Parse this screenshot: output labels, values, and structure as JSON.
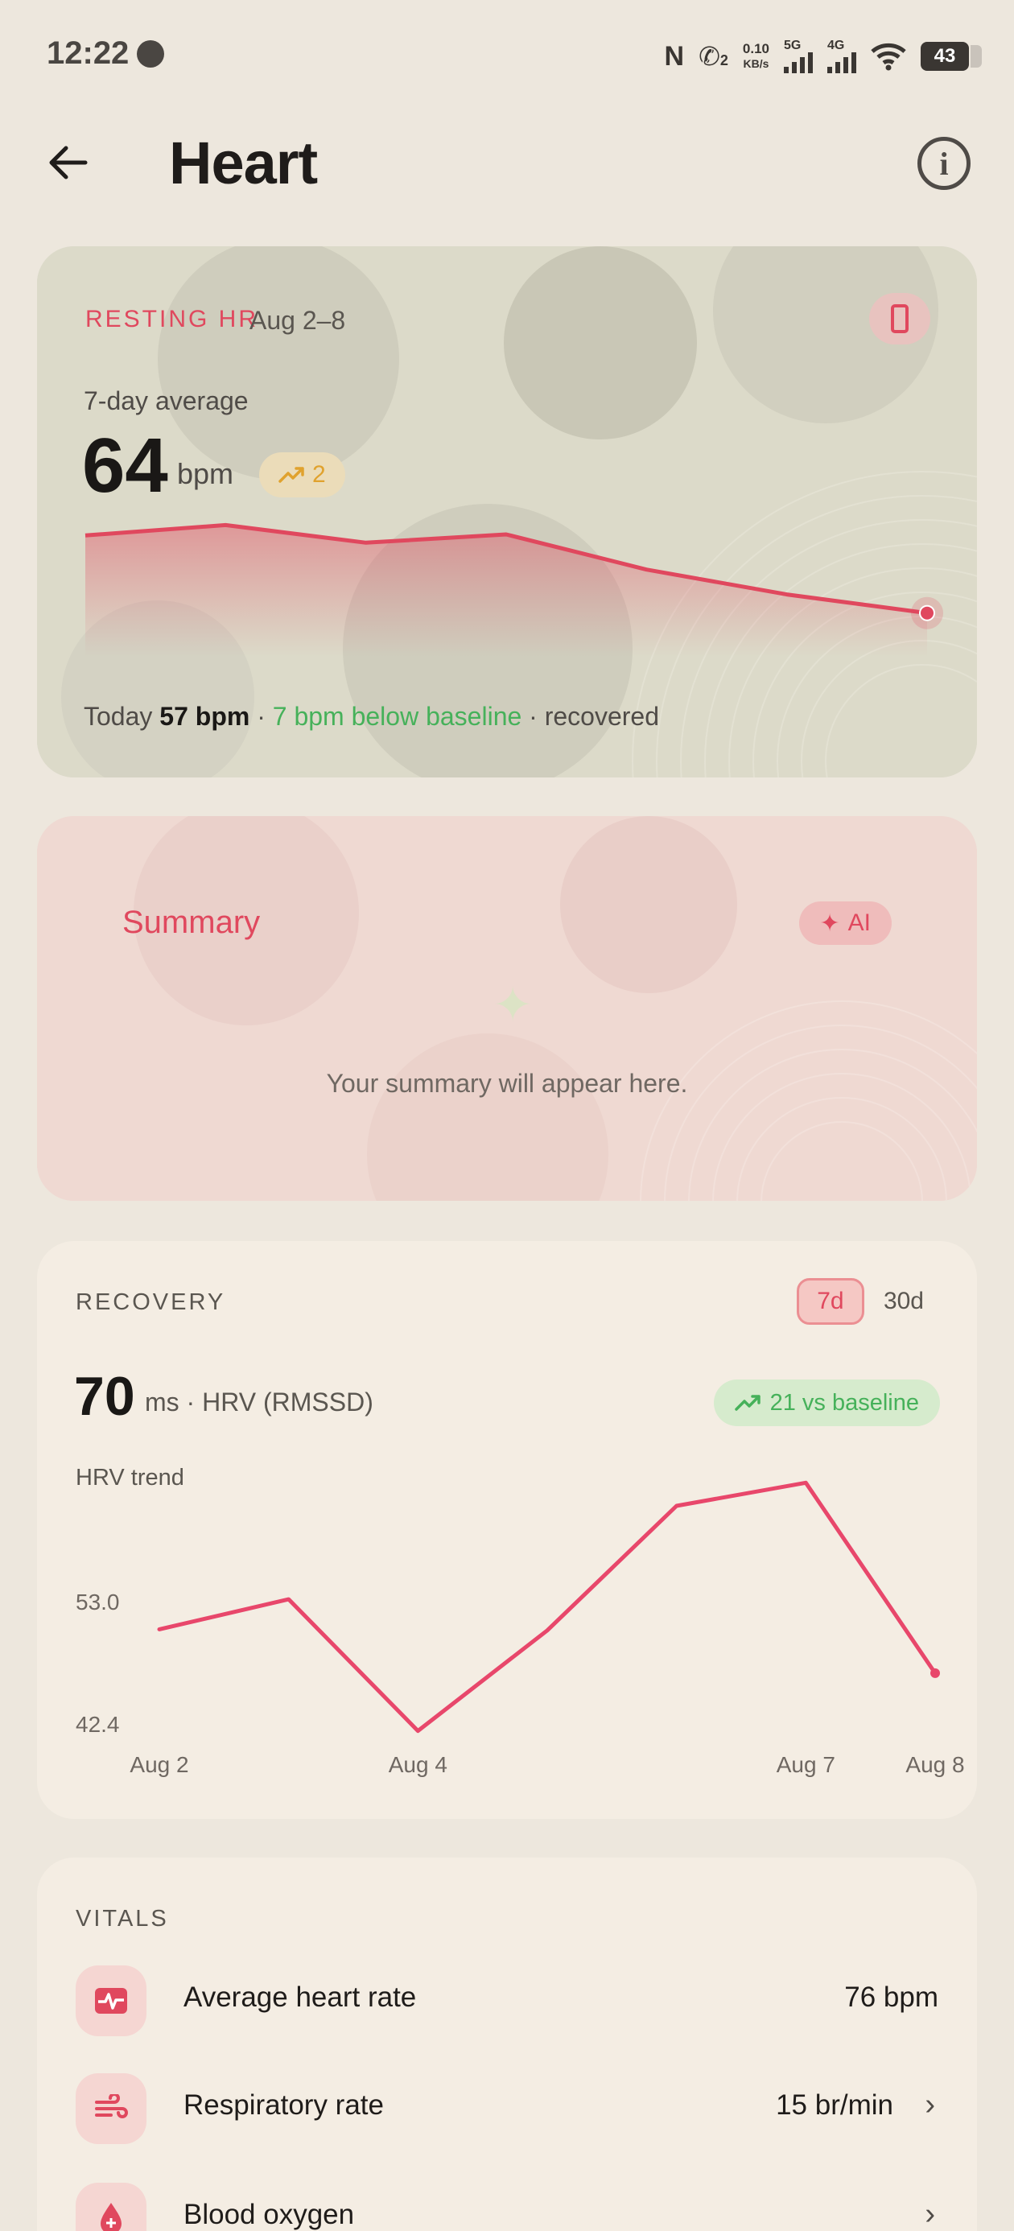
{
  "status_bar": {
    "time": "12:22",
    "speed_value": "0.10",
    "speed_unit": "KB/s",
    "sim1_label": "5G",
    "sim2_label": "4G",
    "call_sub": "2",
    "battery": "43"
  },
  "header": {
    "title": "Heart"
  },
  "resting_hr": {
    "label": "RESTING HR",
    "range": "Aug 2–8",
    "sub_label": "7-day average",
    "value": "64",
    "unit": "bpm",
    "trend_value": "2",
    "footer_prefix": "Today",
    "footer_value": "57 bpm",
    "footer_sep1": " · ",
    "footer_delta": "7 bpm below baseline",
    "footer_suffix": " · recovered",
    "colors": {
      "accent": "#e0485e",
      "trend": "#e0a22e",
      "good": "#46b15a"
    },
    "sparkline": [
      64.5,
      65.5,
      63.8,
      64.6,
      61.2,
      58.8,
      57.0
    ]
  },
  "summary": {
    "title": "Summary",
    "ai_label": "AI",
    "placeholder": "Your summary will appear here."
  },
  "recovery": {
    "label": "RECOVERY",
    "tabs": [
      "7d",
      "30d"
    ],
    "active_tab": "7d",
    "value": "70",
    "unit": "ms · HRV (RMSSD)",
    "badge": "21 vs baseline",
    "chart_title": "HRV trend"
  },
  "chart_data": {
    "type": "line",
    "title": "HRV trend",
    "x": [
      "Aug 2",
      "Aug 3",
      "Aug 4",
      "Aug 5",
      "Aug 6",
      "Aug 7",
      "Aug 8"
    ],
    "x_tick_labels": [
      "Aug 2",
      "Aug 4",
      "Aug 7",
      "Aug 8"
    ],
    "y_tick_labels": [
      "53.0",
      "42.4"
    ],
    "ylim": [
      42.4,
      53.0
    ],
    "series": [
      {
        "values": [
          50.6,
          53.2,
          41.8,
          50.5,
          61.3,
          63.3,
          46.8
        ]
      }
    ],
    "grid": false,
    "color": "#e8476b"
  },
  "vitals": {
    "label": "VITALS",
    "items": [
      {
        "name": "Average heart rate",
        "value": "76 bpm",
        "icon": "heart-pulse-icon"
      },
      {
        "name": "Respiratory rate",
        "value": "15 br/min",
        "icon": "wind-icon"
      },
      {
        "name": "Blood oxygen",
        "value": "",
        "icon": "blood-drop-icon"
      }
    ]
  }
}
